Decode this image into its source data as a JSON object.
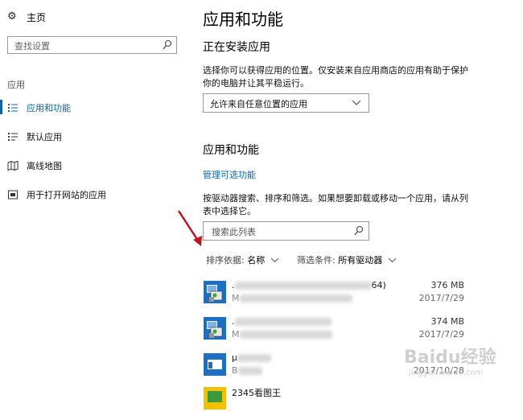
{
  "sidebar": {
    "home_label": "主页",
    "search_placeholder": "查找设置",
    "section_label": "应用",
    "items": [
      {
        "label": "应用和功能",
        "icon": "apps-features-icon",
        "active": true
      },
      {
        "label": "默认应用",
        "icon": "default-apps-icon",
        "active": false
      },
      {
        "label": "离线地图",
        "icon": "offline-maps-icon",
        "active": false
      },
      {
        "label": "用于打开网站的应用",
        "icon": "apps-for-websites-icon",
        "active": false
      }
    ]
  },
  "main": {
    "title": "应用和功能",
    "installing": {
      "heading": "正在安装应用",
      "description": "选择你可以获得应用的位置。仅安装来自应用商店的应用有助于保护你的电脑并让其平稳运行。",
      "dropdown_value": "允许来自任意位置的应用"
    },
    "apps": {
      "heading": "应用和功能",
      "manage_link": "管理可选功能",
      "description": "按驱动器搜索、排序和筛选。如果想要卸载或移动一个应用，请从列表中选择它。",
      "search_placeholder": "搜索此列表",
      "sort_label": "排序依据:",
      "sort_value": "名称",
      "filter_label": "筛选条件:",
      "filter_value": "所有驱动器",
      "list": [
        {
          "name_start": ".",
          "name_end": "64)",
          "sub_start": "M",
          "size": "376 MB",
          "date": "2017/7/29",
          "icon": "installer-icon"
        },
        {
          "name_start": ".",
          "name_end": "",
          "sub_start": "M",
          "size": "374 MB",
          "date": "2017/7/29",
          "icon": "installer-icon"
        },
        {
          "name_start": "μ",
          "name_end": "",
          "sub_start": "B",
          "size": "",
          "date": "2017/10/28",
          "icon": "window-app-icon"
        },
        {
          "name_start": "2345看图王",
          "name_end": "",
          "sub_start": "",
          "size": "",
          "date": "",
          "icon": "image-viewer-icon"
        }
      ]
    }
  },
  "watermark": {
    "text": "Baidu经验",
    "sub": "jingyan.baidu.com"
  },
  "colors": {
    "accent": "#0a64b0",
    "arrow": "#c0141c"
  }
}
